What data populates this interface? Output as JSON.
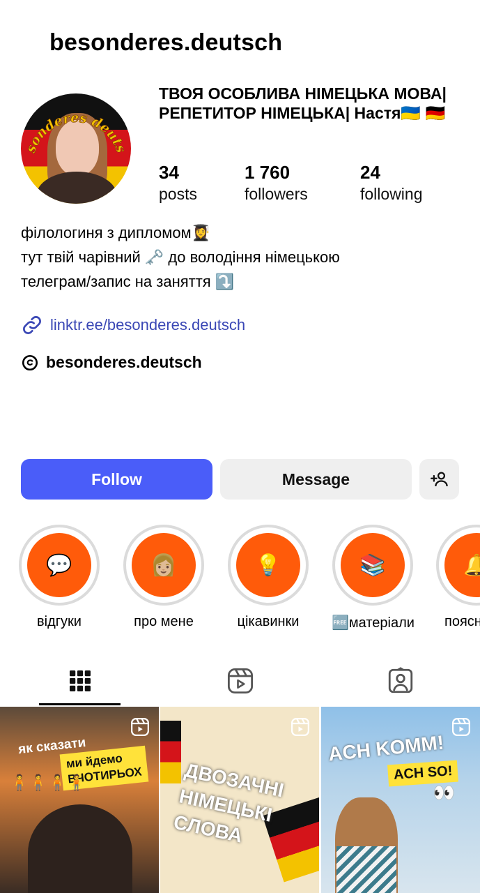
{
  "profile": {
    "username": "besonderes.deutsch",
    "display_name": "ТВОЯ ОСОБЛИВА НІМЕЦЬКА МОВА| РЕПЕТИТОР НІМЕЦЬКА| Настя🇺🇦 🇩🇪",
    "avatar_text": "besonderes deutsch"
  },
  "stats": [
    {
      "value": "34",
      "label": "posts"
    },
    {
      "value": "1 760",
      "label": "followers"
    },
    {
      "value": "24",
      "label": "following"
    }
  ],
  "bio": [
    "філологиня з дипломом👩‍🎓",
    "тут твій чарівний 🗝️ до володіння німецькою",
    "телеграм/запис на заняття ⤵️"
  ],
  "link": {
    "text": "linktr.ee/besonderes.deutsch",
    "icon": "link-icon"
  },
  "threads": {
    "text": "besonderes.deutsch",
    "icon": "threads-icon"
  },
  "actions": {
    "follow": "Follow",
    "message": "Message",
    "add_user_icon": "add-user-icon"
  },
  "highlights": [
    {
      "label": "відгуки",
      "emoji": "💬"
    },
    {
      "label": "про мене",
      "emoji": "👩🏼"
    },
    {
      "label": "цікавинки",
      "emoji": "💡"
    },
    {
      "label": "🆓матеріали",
      "emoji": "📚"
    },
    {
      "label": "поясн",
      "emoji": "🔔"
    }
  ],
  "tabs": [
    {
      "name": "grid-icon",
      "active": true
    },
    {
      "name": "reels-icon",
      "active": false
    },
    {
      "name": "tagged-icon",
      "active": false
    }
  ],
  "posts": [
    {
      "title": "як сказати",
      "box": "ми йдемо\nВЧОТИРЬОХ",
      "emoji": "🧍🧍🧍🧍"
    },
    {
      "text": "ДВОЗАЧНІ\nНІМЕЦЬКІ\nСЛОВА"
    },
    {
      "title": "ACH KOMM!",
      "box": "ACH SO!",
      "emoji": "👀"
    }
  ],
  "colors": {
    "follow": "#4a5df9",
    "highlight": "#ff5b0a",
    "link": "#3a47b5"
  }
}
